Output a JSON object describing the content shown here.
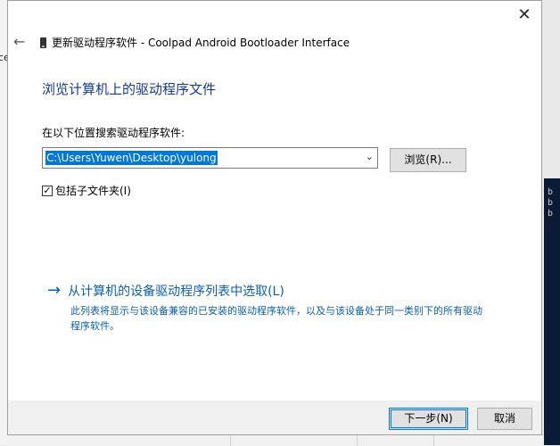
{
  "background": {
    "left_fragment": "ce",
    "right_fragments": [
      "b",
      "b",
      "b"
    ]
  },
  "dialog": {
    "title": "更新驱动程序软件 - Coolpad Android Bootloader Interface",
    "close_symbol": "✕",
    "back_symbol": "←",
    "heading": "浏览计算机上的驱动程序文件",
    "search_label": "在以下位置搜索驱动程序软件:",
    "path_value": "C:\\Users\\Yuwen\\Desktop\\yulong",
    "browse_label": "浏览(R)...",
    "include_subfolders_label": "包括子文件夹(I)",
    "include_subfolders_checked": true,
    "pick_link_label": "从计算机的设备驱动程序列表中选取(L)",
    "pick_link_description": "此列表将显示与该设备兼容的已安装的驱动程序软件，以及与该设备处于同一类别下的所有驱动程序软件。",
    "next_label": "下一步(N)",
    "cancel_label": "取消"
  },
  "icons": {
    "back": "back-arrow-icon",
    "device": "phone-device-icon",
    "close": "close-icon",
    "dropdown": "chevron-down-icon",
    "checkbox": "checkmark-icon",
    "link_arrow": "right-arrow-icon"
  },
  "colors": {
    "heading": "#153a93",
    "link": "#0b5fb5",
    "selection": "#0078d7",
    "footer": "#f0f0f0"
  }
}
